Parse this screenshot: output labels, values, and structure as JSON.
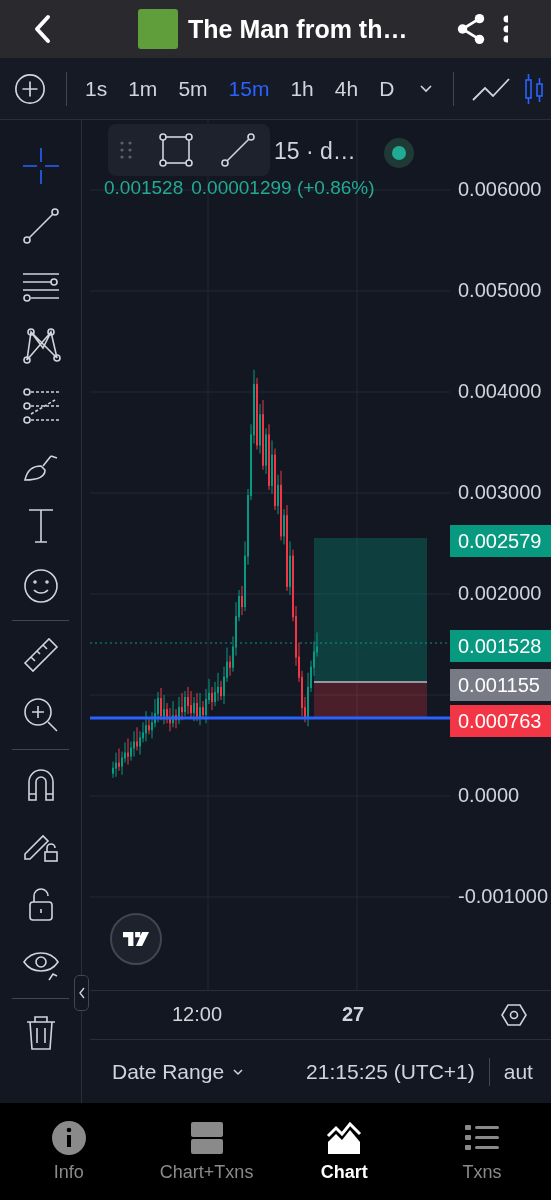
{
  "header": {
    "title": "The Man from th…"
  },
  "timeframes": [
    {
      "label": "1s",
      "selected": false
    },
    {
      "label": "1m",
      "selected": false
    },
    {
      "label": "5m",
      "selected": false
    },
    {
      "label": "15m",
      "selected": true
    },
    {
      "label": "1h",
      "selected": false
    },
    {
      "label": "4h",
      "selected": false
    },
    {
      "label": "D",
      "selected": false
    }
  ],
  "chart_types": [
    {
      "kind": "line",
      "selected": false
    },
    {
      "kind": "candles",
      "selected": true
    }
  ],
  "tool_groups": [
    [
      {
        "kind": "crosshair",
        "selected": true
      },
      {
        "kind": "trendline",
        "selected": false
      },
      {
        "kind": "parallel",
        "selected": false
      },
      {
        "kind": "pattern",
        "selected": false
      },
      {
        "kind": "fib",
        "selected": false
      },
      {
        "kind": "brush",
        "selected": false
      },
      {
        "kind": "text",
        "selected": false
      },
      {
        "kind": "emoji",
        "selected": false
      }
    ],
    [
      {
        "kind": "ruler",
        "selected": false
      },
      {
        "kind": "zoom",
        "selected": false
      }
    ],
    [
      {
        "kind": "magnet",
        "selected": false
      },
      {
        "kind": "drawlock",
        "selected": false
      },
      {
        "kind": "lock",
        "selected": false
      },
      {
        "kind": "eye",
        "selected": false
      }
    ],
    [
      {
        "kind": "trash",
        "selected": false
      }
    ]
  ],
  "legend": {
    "title": "15 · d…",
    "open_value": "0.001528",
    "change": "0.00001299 (+0.86%)"
  },
  "price_axis": [
    {
      "label": "0.006000"
    },
    {
      "label": "0.005000"
    },
    {
      "label": "0.004000"
    },
    {
      "label": "0.003000"
    },
    {
      "label": "0.002000"
    },
    {
      "label": "0.0000"
    },
    {
      "label": "-0.001000"
    }
  ],
  "price_tags": [
    {
      "label": "0.002579",
      "kind": "target"
    },
    {
      "label": "0.001528",
      "kind": "last"
    },
    {
      "label": "0.001155",
      "kind": "entry"
    },
    {
      "label": "0.000763",
      "kind": "stop"
    }
  ],
  "time_axis": [
    {
      "label": "12:00",
      "bold": false
    },
    {
      "label": "27",
      "bold": true
    }
  ],
  "footer": {
    "date_range": "Date Range",
    "time": "21:15:25 (UTC+1)",
    "scale": "aut"
  },
  "nav": [
    {
      "label": "Info",
      "kind": "info",
      "selected": false
    },
    {
      "label": "Chart+Txns",
      "kind": "split",
      "selected": false
    },
    {
      "label": "Chart",
      "kind": "chart",
      "selected": true
    },
    {
      "label": "Txns",
      "kind": "list",
      "selected": false
    }
  ]
}
